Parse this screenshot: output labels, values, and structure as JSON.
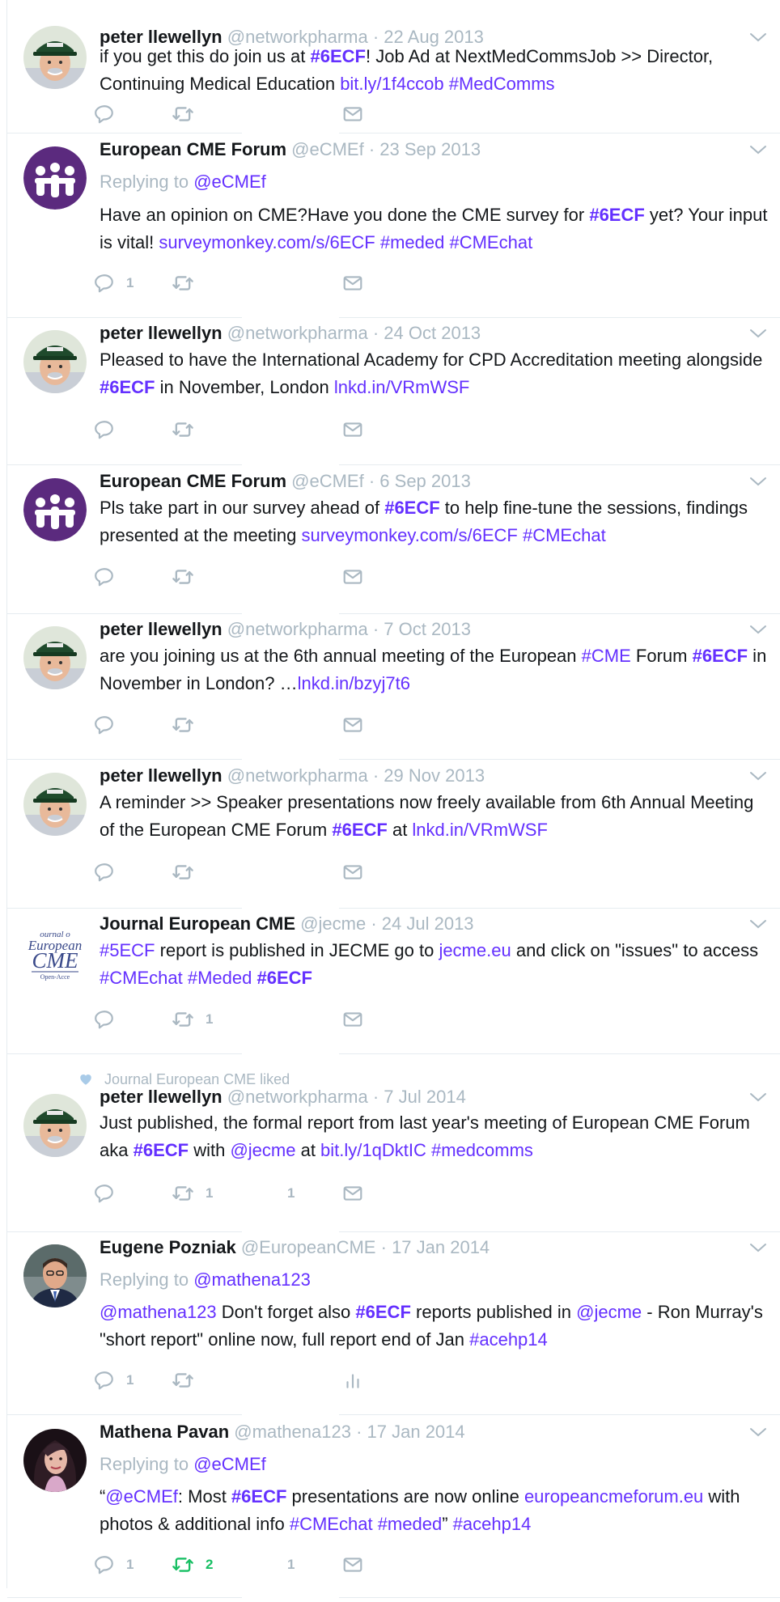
{
  "tweets": [
    {
      "name": "peter llewellyn",
      "handle": "@networkpharma",
      "sep": "·",
      "date": "22 Aug 2013",
      "avatar": "peter",
      "text": [
        {
          "t": "if you get this do join us at "
        },
        {
          "t": "#6ECF",
          "k": "hb"
        },
        {
          "t": "! Job Ad at NextMedCommsJob >> Director, Continuing Medical Education "
        },
        {
          "t": "bit.ly/1f4ccob",
          "k": "l"
        },
        {
          "t": " "
        },
        {
          "t": "#MedComms",
          "k": "h"
        }
      ]
    },
    {
      "name": "European CME Forum",
      "handle": "@eCMEf",
      "sep": "·",
      "date": "23 Sep 2013",
      "avatar": "ecmef",
      "replying_label": "Replying to",
      "replying_to": "@eCMEf",
      "text": [
        {
          "t": "Have an opinion on CME?Have you done the CME survey for "
        },
        {
          "t": "#6ECF",
          "k": "hb"
        },
        {
          "t": " yet? Your input is vital! "
        },
        {
          "t": "surveymonkey.com/s/6ECF",
          "k": "l"
        },
        {
          "t": " "
        },
        {
          "t": "#meded",
          "k": "h"
        },
        {
          "t": " "
        },
        {
          "t": "#CMEchat",
          "k": "h"
        }
      ],
      "reply_count": "1"
    },
    {
      "name": "peter llewellyn",
      "handle": "@networkpharma",
      "sep": "·",
      "date": "24 Oct 2013",
      "avatar": "peter",
      "text": [
        {
          "t": "Pleased to have the International Academy for CPD Accreditation meeting alongside "
        },
        {
          "t": "#6ECF",
          "k": "hb"
        },
        {
          "t": " in November, London "
        },
        {
          "t": "lnkd.in/VRmWSF",
          "k": "l"
        }
      ]
    },
    {
      "name": "European CME Forum",
      "handle": "@eCMEf",
      "sep": "·",
      "date": "6 Sep 2013",
      "avatar": "ecmef",
      "text": [
        {
          "t": "Pls take part in our survey ahead of "
        },
        {
          "t": "#6ECF",
          "k": "hb"
        },
        {
          "t": " to help fine-tune the sessions, findings presented at the meeting "
        },
        {
          "t": "surveymonkey.com/s/6ECF",
          "k": "l"
        },
        {
          "t": " "
        },
        {
          "t": "#CMEchat",
          "k": "h"
        }
      ]
    },
    {
      "name": "peter llewellyn",
      "handle": "@networkpharma",
      "sep": "·",
      "date": "7 Oct 2013",
      "avatar": "peter",
      "text": [
        {
          "t": "are you joining us at the 6th annual meeting of the European "
        },
        {
          "t": "#CME",
          "k": "h"
        },
        {
          "t": " Forum "
        },
        {
          "t": "#6ECF",
          "k": "hb"
        },
        {
          "t": " in November in London? …"
        },
        {
          "t": "lnkd.in/bzyj7t6",
          "k": "l"
        }
      ]
    },
    {
      "name": "peter llewellyn",
      "handle": "@networkpharma",
      "sep": "·",
      "date": "29 Nov 2013",
      "avatar": "peter",
      "text": [
        {
          "t": "A reminder >> Speaker presentations now freely available from 6th Annual Meeting of the European CME Forum "
        },
        {
          "t": "#6ECF",
          "k": "hb"
        },
        {
          "t": " at "
        },
        {
          "t": "lnkd.in/VRmWSF",
          "k": "l"
        }
      ]
    },
    {
      "name": "Journal European CME",
      "handle": "@jecme",
      "sep": "·",
      "date": "24 Jul 2013",
      "avatar": "jecme",
      "avatar_text": {
        "line1": "ournal o",
        "line2": "European",
        "line3": "CME",
        "line4": "Open-Acce"
      },
      "text": [
        {
          "t": "#5ECF",
          "k": "h"
        },
        {
          "t": " report is published in JECME go to "
        },
        {
          "t": "jecme.eu",
          "k": "l"
        },
        {
          "t": " and click on \"issues\" to access "
        },
        {
          "t": "#CMEchat",
          "k": "h"
        },
        {
          "t": " "
        },
        {
          "t": "#Meded",
          "k": "h"
        },
        {
          "t": " "
        },
        {
          "t": "#6ECF",
          "k": "hb"
        }
      ],
      "retweet_count": "1"
    },
    {
      "social": "Journal European CME liked",
      "name": "peter llewellyn",
      "handle": "@networkpharma",
      "sep": "·",
      "date": "7 Jul 2014",
      "avatar": "peter",
      "text": [
        {
          "t": "Just published, the formal report from last year's meeting of European CME Forum aka "
        },
        {
          "t": "#6ECF",
          "k": "hb"
        },
        {
          "t": " with "
        },
        {
          "t": "@jecme",
          "k": "m"
        },
        {
          "t": " at "
        },
        {
          "t": "bit.ly/1qDktIC",
          "k": "l"
        },
        {
          "t": " "
        },
        {
          "t": "#medcomms",
          "k": "h"
        }
      ],
      "retweet_count": "1",
      "like_count": "1"
    },
    {
      "name": "Eugene Pozniak",
      "handle": "@EuropeanCME",
      "sep": "·",
      "date": "17 Jan 2014",
      "avatar": "eugene",
      "replying_label": "Replying to",
      "replying_to": "@mathena123",
      "text": [
        {
          "t": "@mathena123",
          "k": "m"
        },
        {
          "t": " Don't forget also "
        },
        {
          "t": "#6ECF",
          "k": "hb"
        },
        {
          "t": " reports published in "
        },
        {
          "t": "@jecme",
          "k": "m"
        },
        {
          "t": " - Ron Murray's \"short report\" online now, full report end of Jan "
        },
        {
          "t": "#acehp14",
          "k": "h"
        }
      ],
      "reply_count": "1",
      "analytics": true
    },
    {
      "name": "Mathena Pavan",
      "handle": "@mathena123",
      "sep": "·",
      "date": "17 Jan 2014",
      "avatar": "mathena",
      "replying_label": "Replying to",
      "replying_to": "@eCMEf",
      "text": [
        {
          "t": "“"
        },
        {
          "t": "@eCMEf",
          "k": "m"
        },
        {
          "t": ": Most "
        },
        {
          "t": "#6ECF",
          "k": "hb"
        },
        {
          "t": " presentations are now online "
        },
        {
          "t": "europeancmeforum.eu",
          "k": "l"
        },
        {
          "t": " with photos & additional info "
        },
        {
          "t": "#CMEchat",
          "k": "h"
        },
        {
          "t": " "
        },
        {
          "t": "#meded",
          "k": "h"
        },
        {
          "t": "” "
        },
        {
          "t": "#acehp14",
          "k": "h"
        }
      ],
      "reply_count": "1",
      "retweet_count": "2",
      "retweet_active": true,
      "like_count": "1"
    }
  ],
  "colors": {
    "link": "#6430ff",
    "muted": "#aab8c2",
    "retweet_active": "#17bf63",
    "like_heart": "#a9cbe8"
  },
  "icons": {
    "reply": "reply-icon",
    "retweet": "retweet-icon",
    "like": "heart-icon",
    "dm": "envelope-icon",
    "analytics": "analytics-icon",
    "caret": "chevron-down-icon"
  }
}
